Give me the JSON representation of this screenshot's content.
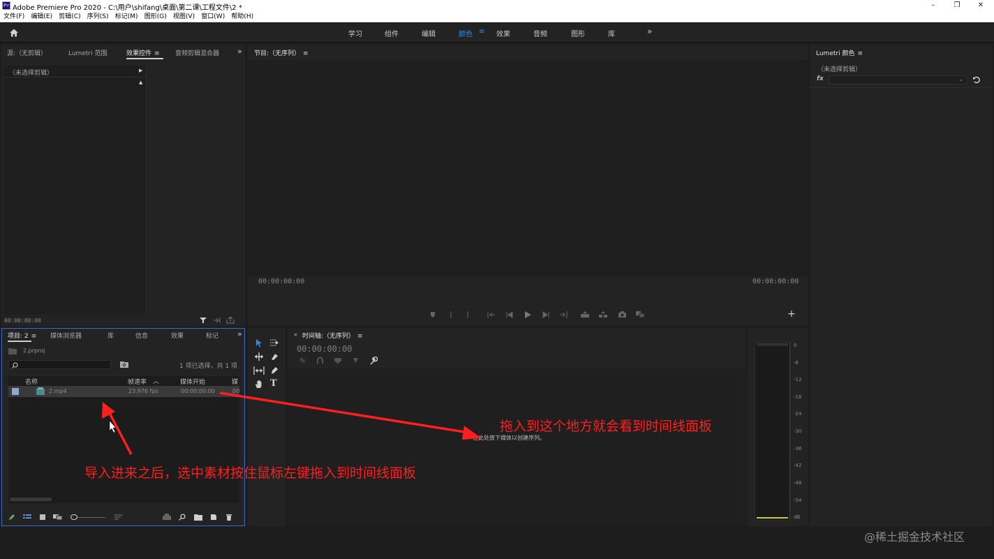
{
  "window": {
    "logo": "Pr",
    "title": "Adobe Premiere Pro 2020 - C:\\用户\\shifang\\桌面\\第二课\\工程文件\\2 *",
    "minimize": "–",
    "restore": "❐",
    "close": "✕"
  },
  "menu": [
    "文件(F)",
    "编辑(E)",
    "剪辑(C)",
    "序列(S)",
    "标记(M)",
    "图形(G)",
    "视图(V)",
    "窗口(W)",
    "帮助(H)"
  ],
  "workspaces": {
    "tabs": [
      "学习",
      "组件",
      "编辑",
      "颜色",
      "效果",
      "音频",
      "图形",
      "库"
    ],
    "active": "颜色",
    "more": "»"
  },
  "source_panel": {
    "tabs": [
      "源:（无剪辑）",
      "Lumetri 范围",
      "效果控件",
      "音频剪辑混合器"
    ],
    "active_tab": "效果控件",
    "no_clip": "（未选择剪辑）",
    "timecode": "00:00:00:00"
  },
  "program_panel": {
    "title": "节目:（无序列）",
    "timecode_left": "00:00:00:00",
    "timecode_right": "00:00:00:00"
  },
  "lumetri_panel": {
    "title": "Lumetri 颜色",
    "no_clip": "（未选择剪辑）",
    "fx": "fx"
  },
  "project_panel": {
    "tabs": [
      "项目: 2",
      "媒体浏览器",
      "库",
      "信息",
      "效果",
      "标记"
    ],
    "active_tab": "项目: 2",
    "project_file": "2.prproj",
    "selection_status": "1 项已选择，共 1 项",
    "columns": [
      "名称",
      "帧速率",
      "媒体开始",
      "媒"
    ],
    "items": [
      {
        "name": "2.mp4",
        "fps": "23.976 fps",
        "media_start": "00:00:00:00",
        "extra": "00"
      }
    ]
  },
  "timeline_panel": {
    "title": "时间轴:（无序列）",
    "timecode": "00:00:00:00",
    "drop_hint": "在此处放下媒体以创建序列。"
  },
  "audio_meter": {
    "scale": [
      "0",
      "-6",
      "-12",
      "-18",
      "-24",
      "-30",
      "-36",
      "-42",
      "-48",
      "-54",
      "dB"
    ]
  },
  "annotations": {
    "drag_hint": "拖入到这个地方就会看到时间线面板",
    "import_hint": "导入进来之后，选中素材按住鼠标左键拖入到时间线面板",
    "color": "#ff1f1f"
  },
  "watermark": "@稀土掘金技术社区",
  "colors": {
    "accent": "#2d8ceb",
    "panel_bg": "#232323",
    "app_bg": "#1d1d1d",
    "focus_border": "#3d6bc7"
  }
}
